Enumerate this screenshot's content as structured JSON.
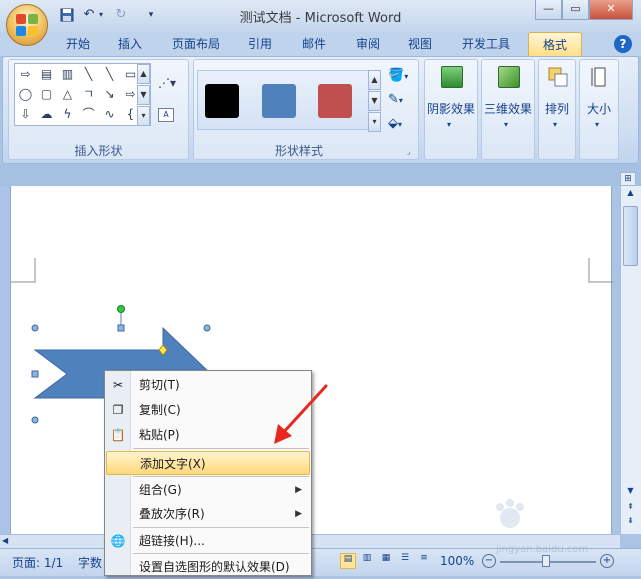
{
  "window": {
    "title": "测试文档 - Microsoft Word"
  },
  "quick_access": [
    "save-icon",
    "undo-icon",
    "redo-icon",
    "customize-icon"
  ],
  "tabs": [
    {
      "label": "开始"
    },
    {
      "label": "插入"
    },
    {
      "label": "页面布局"
    },
    {
      "label": "引用"
    },
    {
      "label": "邮件"
    },
    {
      "label": "审阅"
    },
    {
      "label": "视图"
    },
    {
      "label": "开发工具"
    },
    {
      "label": "格式",
      "active": true
    }
  ],
  "ribbon": {
    "insert_shapes_label": "插入形状",
    "shape_styles_label": "形状样式",
    "shadow_label": "阴影效果",
    "threed_label": "三维效果",
    "arrange_label": "排列",
    "size_label": "大小",
    "swatches": [
      "#000000",
      "#4f81bd",
      "#c0504d"
    ]
  },
  "context_menu": {
    "items": [
      {
        "label": "剪切(T)",
        "icon": "cut-icon"
      },
      {
        "label": "复制(C)",
        "icon": "copy-icon"
      },
      {
        "label": "粘贴(P)",
        "icon": "paste-icon"
      },
      {
        "label": "添加文字(X)",
        "highlighted": true
      },
      {
        "label": "组合(G)",
        "submenu": true
      },
      {
        "label": "叠放次序(R)",
        "submenu": true
      },
      {
        "label": "超链接(H)...",
        "icon": "hyperlink-icon"
      },
      {
        "label": "设置自选图形的默认效果(D)"
      }
    ]
  },
  "status": {
    "page": "页面: 1/1",
    "words": "字数",
    "zoom": "100%"
  },
  "watermark": "jingyan.baidu.com",
  "colors": {
    "accent": "#15428b",
    "highlight": "#ffd97a",
    "shape_fill": "#4f81bd",
    "arrow_annotation": "#e8281f"
  }
}
